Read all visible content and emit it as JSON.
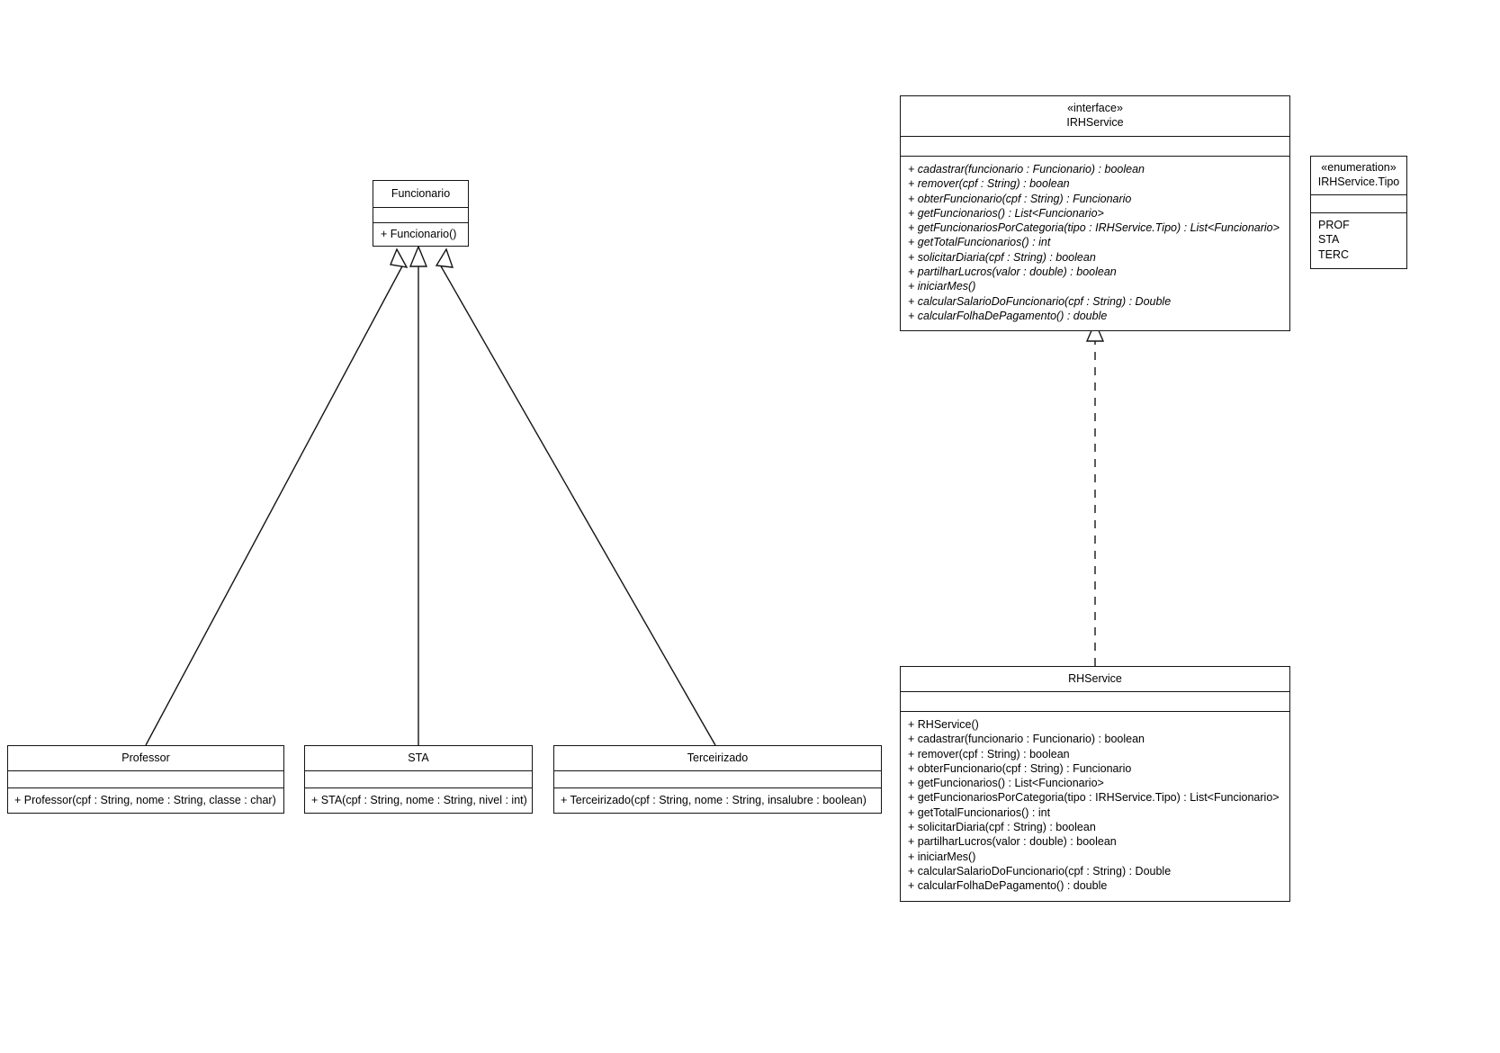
{
  "diagram": {
    "kind": "uml-class-diagram",
    "background_color": "#ffffff",
    "line_color": "#141414"
  },
  "classes": {
    "funcionario": {
      "name": "Funcionario",
      "stereotype": "",
      "attributes": [],
      "operations": [
        "+ Funcionario()"
      ]
    },
    "professor": {
      "name": "Professor",
      "stereotype": "",
      "attributes": [],
      "operations": [
        "+ Professor(cpf : String, nome : String, classe : char)"
      ]
    },
    "sta": {
      "name": "STA",
      "stereotype": "",
      "attributes": [],
      "operations": [
        "+ STA(cpf : String, nome : String, nivel : int)"
      ]
    },
    "terceirizado": {
      "name": "Terceirizado",
      "stereotype": "",
      "attributes": [],
      "operations": [
        "+ Terceirizado(cpf : String, nome : String, insalubre : boolean)"
      ]
    },
    "irhservice": {
      "name": "IRHService",
      "stereotype": "«interface»",
      "attributes": [],
      "operations": [
        "+ cadastrar(funcionario : Funcionario) : boolean",
        "+ remover(cpf : String) : boolean",
        "+ obterFuncionario(cpf : String) : Funcionario",
        "+ getFuncionarios() : List<Funcionario>",
        "+ getFuncionariosPorCategoria(tipo : IRHService.Tipo) : List<Funcionario>",
        "+ getTotalFuncionarios() : int",
        "+ solicitarDiaria(cpf : String) : boolean",
        "+ partilharLucros(valor : double) : boolean",
        "+ iniciarMes()",
        "+ calcularSalarioDoFuncionario(cpf : String) : Double",
        "+ calcularFolhaDePagamento() : double"
      ]
    },
    "enumeration": {
      "name": "IRHService.Tipo",
      "stereotype": "«enumeration»",
      "attributes": [],
      "operations": [
        "PROF",
        "STA",
        "TERC"
      ]
    },
    "rhservice": {
      "name": "RHService",
      "stereotype": "",
      "attributes": [],
      "operations": [
        "+ RHService()",
        "+ cadastrar(funcionario : Funcionario) : boolean",
        "+ remover(cpf : String) : boolean",
        "+ obterFuncionario(cpf : String) : Funcionario",
        "+ getFuncionarios() : List<Funcionario>",
        "+ getFuncionariosPorCategoria(tipo : IRHService.Tipo) : List<Funcionario>",
        "+ getTotalFuncionarios() : int",
        "+ solicitarDiaria(cpf : String) : boolean",
        "+ partilharLucros(valor : double) : boolean",
        "+ iniciarMes()",
        "+ calcularSalarioDoFuncionario(cpf : String) : Double",
        "+ calcularFolhaDePagamento() : double"
      ]
    }
  },
  "relationships": [
    {
      "type": "generalization",
      "from": "Professor",
      "to": "Funcionario",
      "style": "solid-hollow-triangle"
    },
    {
      "type": "generalization",
      "from": "STA",
      "to": "Funcionario",
      "style": "solid-hollow-triangle"
    },
    {
      "type": "generalization",
      "from": "Terceirizado",
      "to": "Funcionario",
      "style": "solid-hollow-triangle"
    },
    {
      "type": "realization",
      "from": "RHService",
      "to": "IRHService",
      "style": "dashed-hollow-triangle"
    }
  ]
}
